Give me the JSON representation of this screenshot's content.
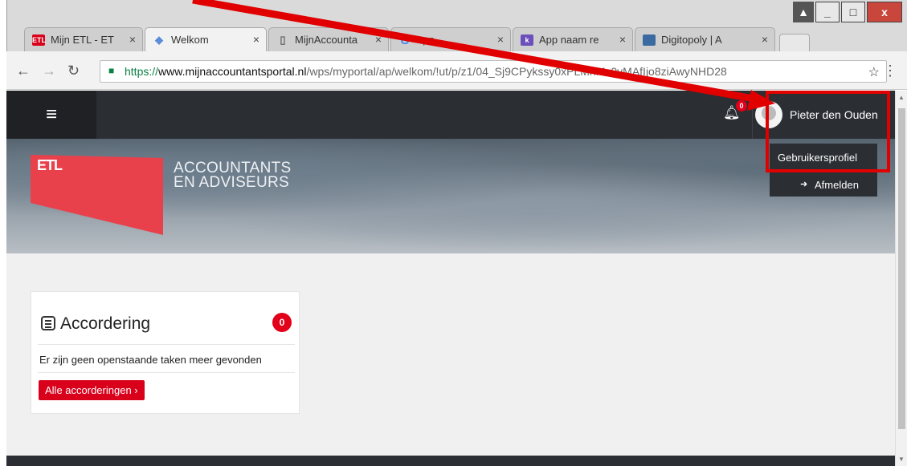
{
  "browser": {
    "tabs": [
      {
        "label": "Mijn ETL - ET",
        "favicon": "etl-favicon",
        "color": "#d9001b"
      },
      {
        "label": "Welkom",
        "favicon": "welcome-favicon",
        "color": "#5b8dd9"
      },
      {
        "label": "MijnAccounta",
        "favicon": "page-favicon",
        "color": "#888888"
      },
      {
        "label": "app",
        "favicon": "google-favicon",
        "color": "#4285f4"
      },
      {
        "label": "App naam re",
        "favicon": "k-favicon",
        "color": "#6b4fbb"
      },
      {
        "label": "Digitopoly | A",
        "favicon": "digitopoly-favicon",
        "color": "#3b6aa0"
      }
    ],
    "close_glyph": "×",
    "url": {
      "scheme": "https://",
      "host": "www.mijnaccountantsportal.nl",
      "path": "/wps/myportal/ap/welkom/!ut/p/z1/04_Sj9CPykss",
      "path_tail": "y0xPLMnMz0vMAfIjo8ziAwyNHD28"
    },
    "window_controls": {
      "minimize": "_",
      "maximize": "□",
      "close": "x"
    }
  },
  "portal": {
    "notification_count": "0",
    "user_name": "Pieter den Ouden",
    "menu": {
      "profile": "Gebruikersprofiel",
      "logout": "Afmelden"
    },
    "brand": {
      "logo": "ETL",
      "tagline_line1": "ACCOUNTANTS",
      "tagline_line2": "EN ADVISEURS",
      "accent": "#e8414c"
    },
    "card": {
      "title": "Accordering",
      "badge": "0",
      "message": "Er zijn geen openstaande taken meer gevonden",
      "button": "Alle accorderingen ›"
    }
  }
}
